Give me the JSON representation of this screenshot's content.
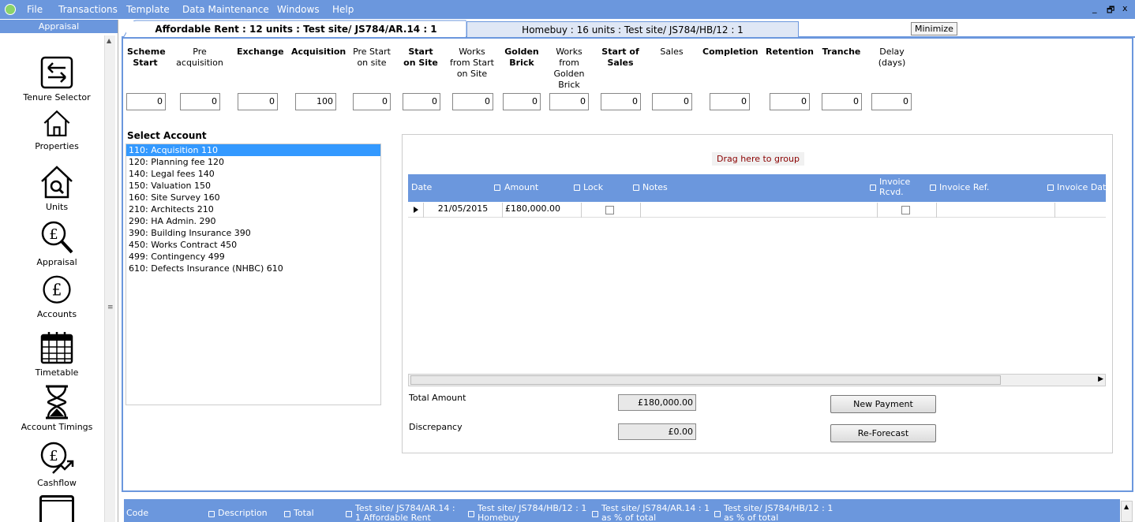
{
  "menu": {
    "file": "File",
    "transactions": "Transactions",
    "template": "Template",
    "data_maintenance": "Data Maintenance",
    "windows": "Windows",
    "help": "Help",
    "win_minimize": "_",
    "win_restore": "🗗",
    "win_close": "x"
  },
  "sidebar": {
    "header": "Appraisal",
    "items": [
      {
        "label": "Tenure Selector",
        "icon": "arrows-swap-icon"
      },
      {
        "label": "Properties",
        "icon": "house-icon"
      },
      {
        "label": "Units",
        "icon": "house-search-icon"
      },
      {
        "label": "Appraisal",
        "icon": "pound-magnifier-icon"
      },
      {
        "label": "Accounts",
        "icon": "pound-circle-icon"
      },
      {
        "label": "Timetable",
        "icon": "calendar-icon"
      },
      {
        "label": "Account Timings",
        "icon": "hourglass-icon"
      },
      {
        "label": "Cashflow",
        "icon": "pound-growth-icon"
      }
    ]
  },
  "tabs": {
    "active": "Affordable Rent : 12 units : Test site/ JS784/AR.14 : 1",
    "second": "Homebuy : 16 units : Test site/ JS784/HB/12 : 1",
    "tooltip": "Minimize"
  },
  "milestones": [
    {
      "label": "Scheme Start",
      "value": "0"
    },
    {
      "label": "Pre acquisition",
      "value": "0"
    },
    {
      "label": "Exchange",
      "value": "0"
    },
    {
      "label": "Acquisition",
      "value": "100"
    },
    {
      "label": "Pre Start on site",
      "value": "0"
    },
    {
      "label": "Start on Site",
      "value": "0"
    },
    {
      "label": "Works from Start on Site",
      "value": "0"
    },
    {
      "label": "Golden Brick",
      "value": "0"
    },
    {
      "label": "Works from Golden Brick",
      "value": "0"
    },
    {
      "label": "Start of Sales",
      "value": "0"
    },
    {
      "label": "Sales",
      "value": "0"
    },
    {
      "label": "Completion",
      "value": "0"
    },
    {
      "label": "Retention",
      "value": "0"
    },
    {
      "label": "Tranche",
      "value": "0"
    },
    {
      "label": "Delay (days)",
      "value": "0"
    }
  ],
  "accounts": {
    "title": "Select Account",
    "items": [
      "110: Acquisition  110",
      "120: Planning fee  120",
      "140: Legal fees  140",
      "150: Valuation  150",
      "160: Site Survey  160",
      "210: Architects  210",
      "290: HA Admin.  290",
      "390: Building Insurance  390",
      "450: Works Contract  450",
      "499: Contingency  499",
      "610: Defects Insurance (NHBC)  610"
    ]
  },
  "grid": {
    "drag_hint": "Drag here to group",
    "columns": [
      "Date",
      "Amount",
      "Lock",
      "Notes",
      "Invoice Rcvd.",
      "Invoice Ref.",
      "Invoice Date"
    ],
    "rows": [
      {
        "date": "21/05/2015",
        "amount": "£180,000.00"
      }
    ]
  },
  "totals": {
    "total_label": "Total Amount",
    "total_value": "£180,000.00",
    "discrepancy_label": "Discrepancy",
    "discrepancy_value": "£0.00"
  },
  "buttons": {
    "new_payment": "New Payment",
    "reforecast": "Re-Forecast"
  },
  "bottom_grid": {
    "columns": [
      "Code",
      "Description",
      "Total",
      "Test site/ JS784/AR.14 : 1 Affordable Rent",
      "Test site/ JS784/HB/12 : 1 Homebuy",
      "Test site/ JS784/AR.14 : 1 as % of total",
      "Test site/ JS784/HB/12 : 1 as % of total"
    ]
  }
}
